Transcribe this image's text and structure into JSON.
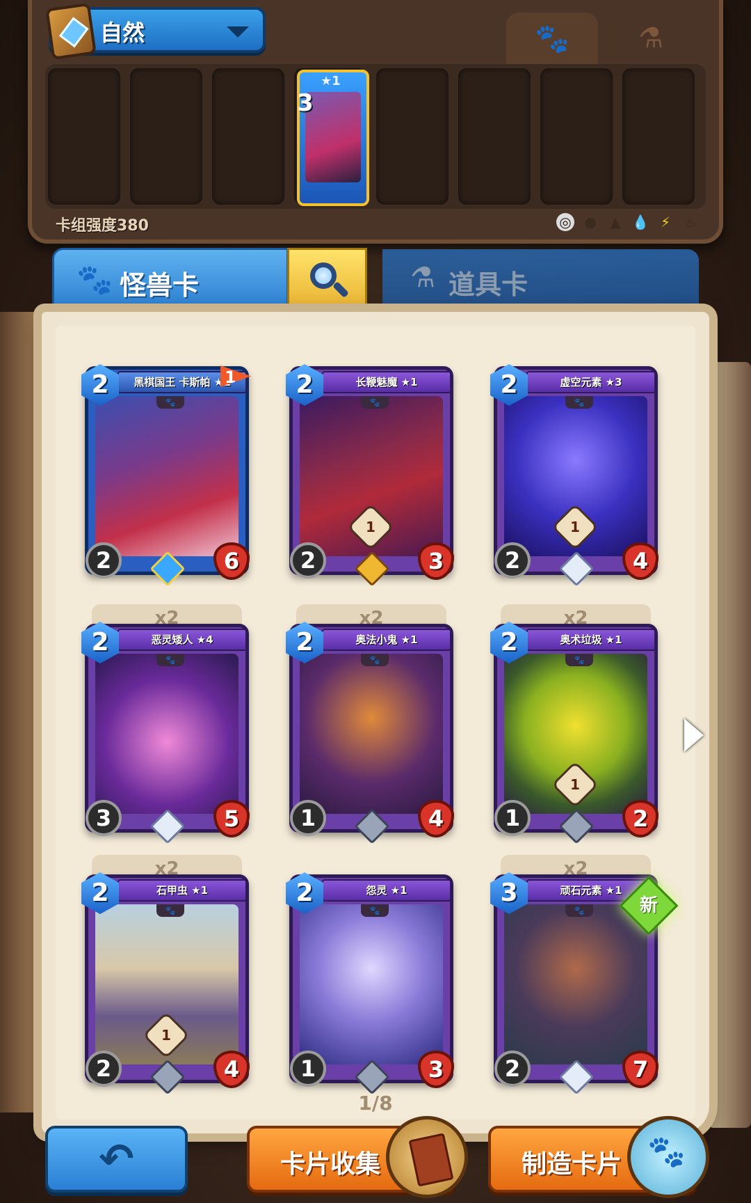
{
  "deck": {
    "name": "自然",
    "power_label": "卡组强度380",
    "card_rarity": "★1",
    "card_cost": "3",
    "element_icons": [
      "neutral-icon",
      "demon-icon",
      "beast-icon",
      "water-icon",
      "lightning-icon",
      "fire-icon"
    ]
  },
  "tabs": {
    "monster": "怪兽卡",
    "item": "道具卡"
  },
  "cards": [
    {
      "name": "黑棋国王 卡斯帕 ★1",
      "cost": "2",
      "attack": "2",
      "health": "6",
      "flag": "1",
      "copies": "",
      "style": "blue",
      "gem": "star"
    },
    {
      "name": "长鞭魅魔 ★1",
      "cost": "2",
      "attack": "2",
      "health": "3",
      "flag": "",
      "copies": "",
      "style": "purple",
      "gem": "gold",
      "trait": "1"
    },
    {
      "name": "虚空元素 ★3",
      "cost": "2",
      "attack": "2",
      "health": "4",
      "flag": "",
      "copies": "",
      "style": "purple",
      "gem": "white",
      "trait": "1"
    },
    {
      "name": "恶灵矮人 ★4",
      "cost": "2",
      "attack": "3",
      "health": "5",
      "flag": "",
      "copies": "x2",
      "style": "purple",
      "gem": "white"
    },
    {
      "name": "奥法小鬼 ★1",
      "cost": "2",
      "attack": "1",
      "health": "4",
      "flag": "",
      "copies": "x2",
      "style": "purple",
      "gem": "grey"
    },
    {
      "name": "奥术垃圾 ★1",
      "cost": "2",
      "attack": "1",
      "health": "2",
      "flag": "",
      "copies": "x2",
      "style": "purple",
      "gem": "grey",
      "trait": "1"
    },
    {
      "name": "石甲虫 ★1",
      "cost": "2",
      "attack": "2",
      "health": "4",
      "flag": "",
      "copies": "x2",
      "style": "purple",
      "gem": "grey",
      "trait": "1"
    },
    {
      "name": "怨灵 ★1",
      "cost": "2",
      "attack": "1",
      "health": "3",
      "flag": "",
      "copies": "",
      "style": "purple",
      "gem": "grey"
    },
    {
      "name": "顽石元素 ★1",
      "cost": "3",
      "attack": "2",
      "health": "7",
      "flag": "",
      "copies": "x2",
      "style": "purple",
      "gem": "white",
      "new": "新"
    }
  ],
  "pager": "1/8",
  "buttons": {
    "collect": "卡片收集",
    "craft": "制造卡片"
  },
  "colors": {
    "monster_tab": "#3a95e0",
    "search": "#f2c232",
    "action": "#f28a2a",
    "card_purple": "#6b3fa8",
    "health": "#d8342a"
  }
}
